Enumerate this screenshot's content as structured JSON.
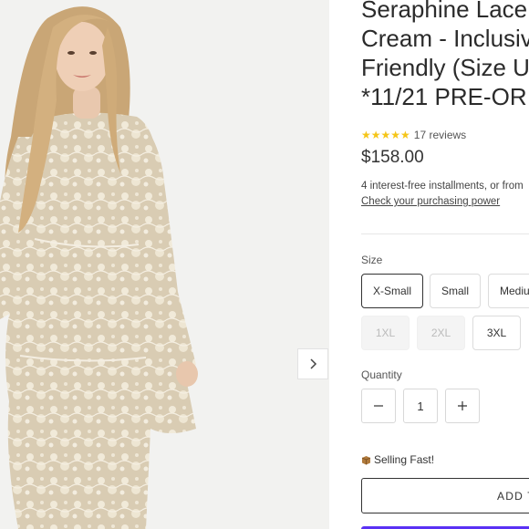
{
  "product": {
    "title": "Seraphine Lace\nCream - Inclusiv\nFriendly (Size U\n*11/21 PRE-OR",
    "stars": "★★★★★",
    "reviews": "17 reviews",
    "price": "$158.00",
    "installments": "4 interest-free installments, or from",
    "purchasing_power_link": "Check your purchasing power",
    "accent_star_color": "#f5c518"
  },
  "size": {
    "label": "Size",
    "options": [
      {
        "label": "X-Small",
        "state": "selected"
      },
      {
        "label": "Small",
        "state": "available"
      },
      {
        "label": "Mediu",
        "state": "available"
      },
      {
        "label": "1XL",
        "state": "unavailable"
      },
      {
        "label": "2XL",
        "state": "unavailable"
      },
      {
        "label": "3XL",
        "state": "available"
      }
    ]
  },
  "quantity": {
    "label": "Quantity",
    "value": "1",
    "minus_icon": "minus-icon",
    "plus_icon": "plus-icon"
  },
  "status": {
    "selling_fast": "Selling Fast!",
    "icon": "package-icon"
  },
  "cart": {
    "add_label": "ADD T"
  },
  "gallery": {
    "next_icon": "chevron-right-icon"
  }
}
